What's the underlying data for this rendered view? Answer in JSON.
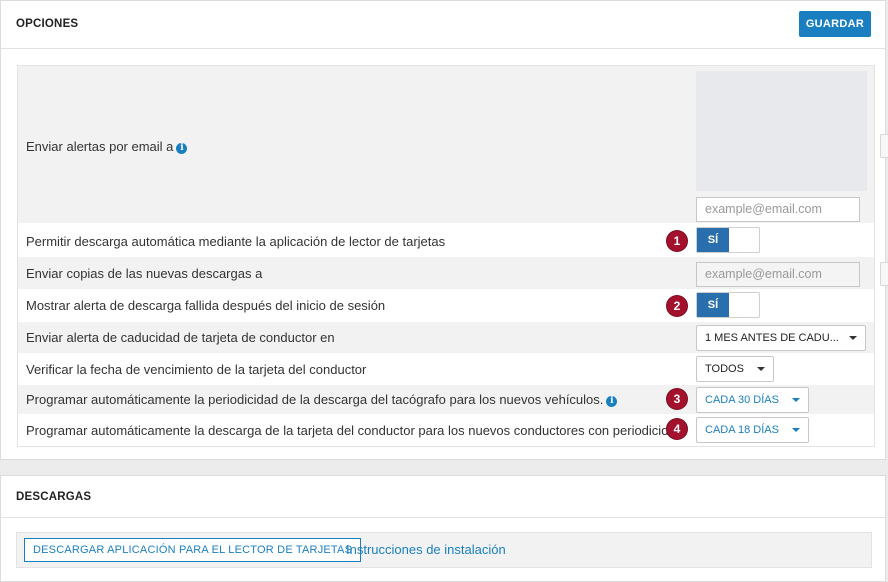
{
  "options": {
    "title": "OPCIONES",
    "save_label": "GUARDAR",
    "rows": {
      "email_alerts": {
        "label": "Enviar alertas por email a",
        "placeholder": "example@email.com"
      },
      "auto_download": {
        "label": "Permitir descarga automática mediante la aplicación de lector de tarjetas",
        "badge": "1",
        "toggle": "SÍ"
      },
      "copies": {
        "label": "Enviar copias de las nuevas descargas a",
        "placeholder": "example@email.com"
      },
      "failed_alert": {
        "label": "Mostrar alerta de descarga fallida después del inicio de sesión",
        "badge": "2",
        "toggle": "SÍ"
      },
      "expiry_alert": {
        "label": "Enviar alerta de caducidad de tarjeta de conductor en",
        "value": "1 MES ANTES DE CADU..."
      },
      "verify_expiry": {
        "label": "Verificar la fecha de vencimiento de la tarjeta del conductor",
        "value": "TODOS"
      },
      "tacho_period": {
        "label": "Programar automáticamente la periodicidad de la descarga del tacógrafo para los nuevos vehículos.",
        "badge": "3",
        "value": "CADA 30 DÍAS"
      },
      "card_period": {
        "label": "Programar automáticamente la descarga de la tarjeta del conductor para los nuevos conductores con periodicidad",
        "badge": "4",
        "value": "CADA 18 DÍAS"
      }
    }
  },
  "downloads": {
    "title": "DESCARGAS",
    "app_button": "DESCARGAR APLICACIÓN PARA EL LECTOR DE TARJETAS",
    "instructions_link": "Instrucciones de instalación"
  },
  "colors": {
    "accent": "#1a7fc1",
    "badge": "#a3112c",
    "toggle_on": "#2a6fad"
  },
  "icons": {
    "info": "info-icon",
    "dropdown": "chevron-down-icon"
  }
}
